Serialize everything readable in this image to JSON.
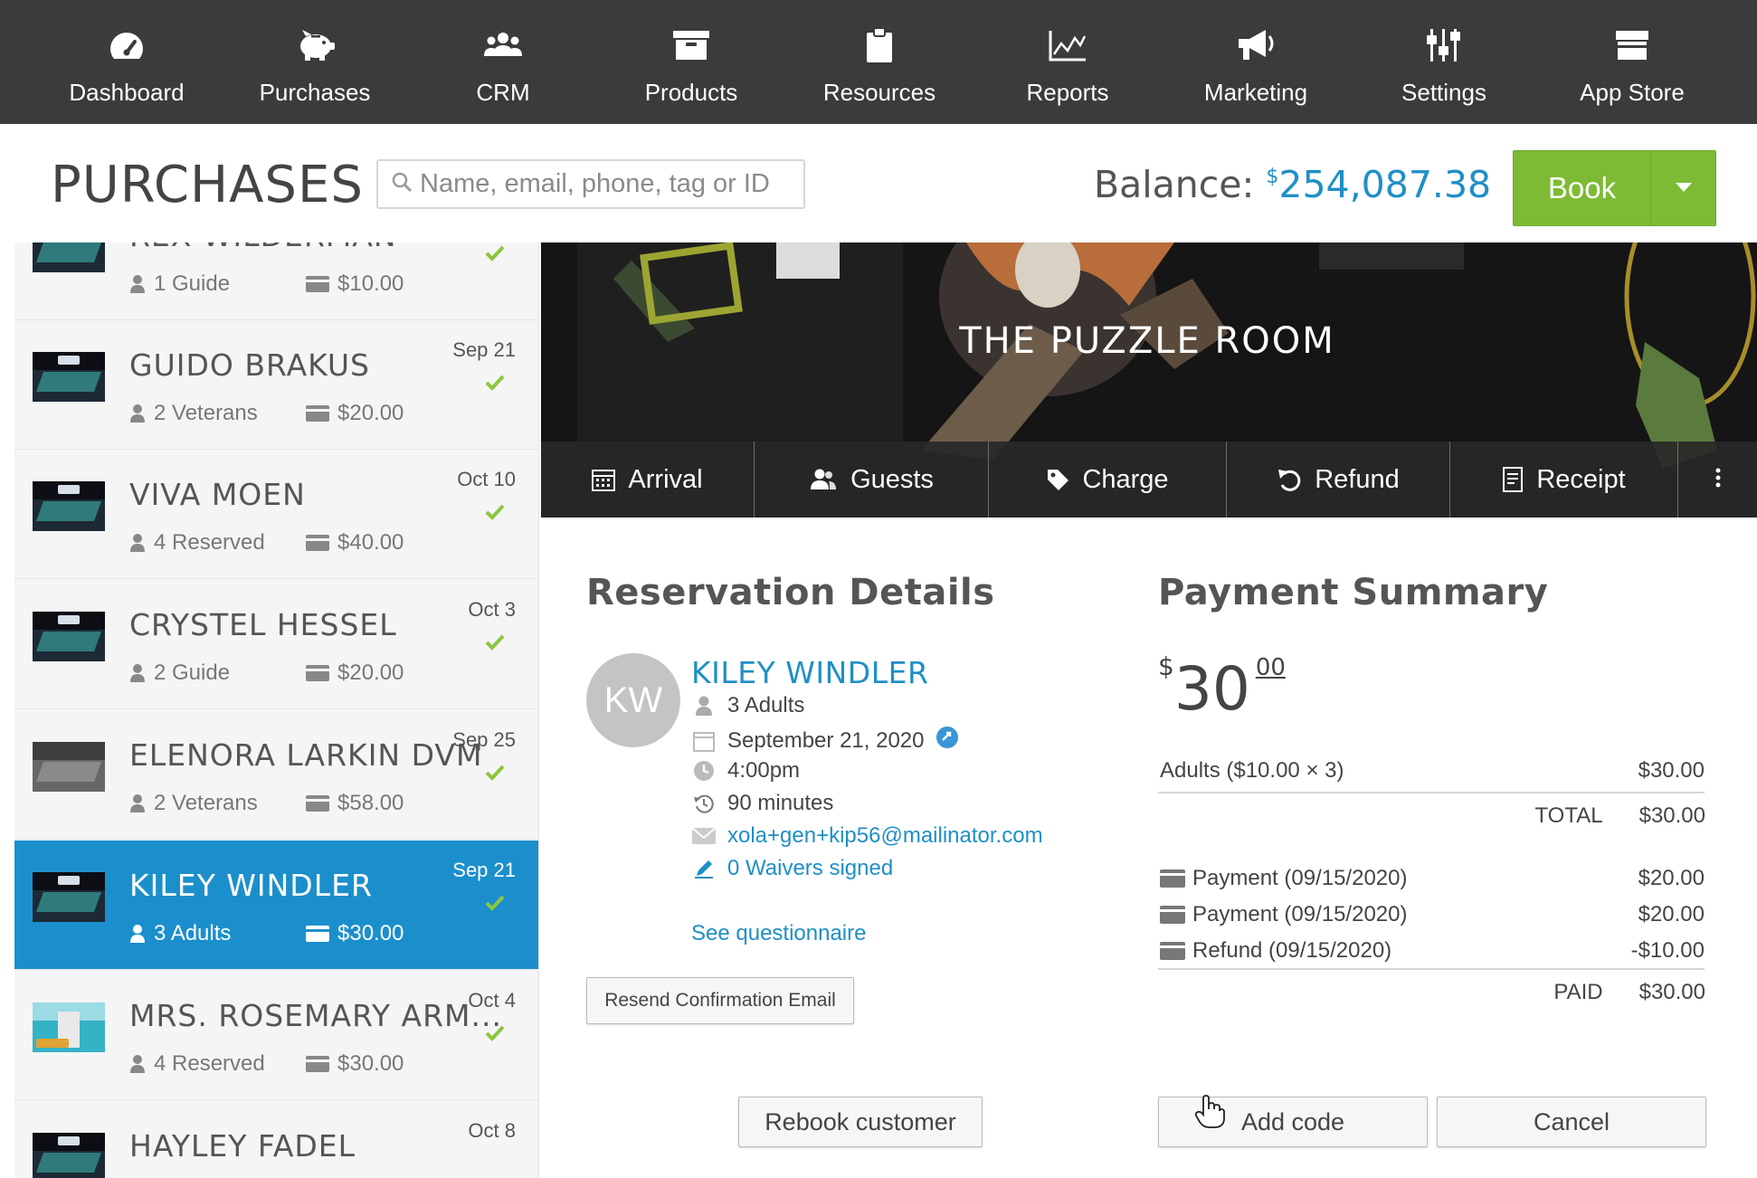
{
  "nav": {
    "items": [
      {
        "label": "Dashboard",
        "icon": "dashboard-gauge-icon"
      },
      {
        "label": "Purchases",
        "icon": "piggy-bank-icon"
      },
      {
        "label": "CRM",
        "icon": "users-group-icon"
      },
      {
        "label": "Products",
        "icon": "archive-box-icon"
      },
      {
        "label": "Resources",
        "icon": "clipboard-icon"
      },
      {
        "label": "Reports",
        "icon": "line-chart-icon"
      },
      {
        "label": "Marketing",
        "icon": "megaphone-icon"
      },
      {
        "label": "Settings",
        "icon": "sliders-icon"
      },
      {
        "label": "App Store",
        "icon": "store-icon"
      }
    ]
  },
  "header": {
    "title": "PURCHASES",
    "search_placeholder": "Name, email, phone, tag or ID",
    "balance_label": "Balance:",
    "balance_currency": "$",
    "balance_amount": "254,087.38",
    "book_label": "Book"
  },
  "purchases": [
    {
      "name": "REX WILDERMAN",
      "date": "",
      "guests": "1 Guide",
      "price": "$10.00",
      "active": false
    },
    {
      "name": "GUIDO BRAKUS",
      "date": "Sep 21",
      "guests": "2 Veterans",
      "price": "$20.00",
      "active": false
    },
    {
      "name": "VIVA MOEN",
      "date": "Oct 10",
      "guests": "4 Reserved",
      "price": "$40.00",
      "active": false
    },
    {
      "name": "CRYSTEL HESSEL",
      "date": "Oct 3",
      "guests": "2 Guide",
      "price": "$20.00",
      "active": false
    },
    {
      "name": "ELENORA LARKIN DVM",
      "date": "Sep 25",
      "guests": "2 Veterans",
      "price": "$58.00",
      "active": false
    },
    {
      "name": "KILEY WINDLER",
      "date": "Sep 21",
      "guests": "3 Adults",
      "price": "$30.00",
      "active": true
    },
    {
      "name": "MRS. ROSEMARY ARM...",
      "date": "Oct 4",
      "guests": "4 Reserved",
      "price": "$30.00",
      "active": false
    },
    {
      "name": "HAYLEY FADEL",
      "date": "Oct 8",
      "guests": "",
      "price": "",
      "active": false
    }
  ],
  "hero": {
    "title": "THE PUZZLE ROOM",
    "actions": [
      {
        "label": "Arrival",
        "icon": "calendar-grid-icon"
      },
      {
        "label": "Guests",
        "icon": "guests-icon"
      },
      {
        "label": "Charge",
        "icon": "tag-icon"
      },
      {
        "label": "Refund",
        "icon": "undo-arrow-icon"
      },
      {
        "label": "Receipt",
        "icon": "receipt-icon"
      }
    ],
    "more_icon": "vertical-ellipsis-icon"
  },
  "reservation": {
    "section_title": "Reservation Details",
    "avatar_initials": "KW",
    "customer_name": "KILEY WINDLER",
    "guests": "3 Adults",
    "date": "September 21, 2020",
    "time": "4:00pm",
    "duration": "90 minutes",
    "email": "xola+gen+kip56@mailinator.com",
    "waivers": "0 Waivers signed",
    "questionnaire": "See questionnaire",
    "resend_label": "Resend Confirmation Email",
    "rebook_label": "Rebook customer"
  },
  "payment": {
    "section_title": "Payment Summary",
    "amount_currency": "$",
    "amount_dollars": "30",
    "amount_cents": "00",
    "line_item_label": "Adults ($10.00 × 3)",
    "line_item_value": "$30.00",
    "total_label": "TOTAL",
    "total_value": "$30.00",
    "transactions": [
      {
        "label": "Payment (09/15/2020)",
        "value": "$20.00"
      },
      {
        "label": "Payment (09/15/2020)",
        "value": "$20.00"
      },
      {
        "label": "Refund (09/15/2020)",
        "value": "-$10.00"
      }
    ],
    "paid_label": "PAID",
    "paid_value": "$30.00",
    "add_code_label": "Add code",
    "cancel_label": "Cancel"
  },
  "colors": {
    "nav_bg": "#3b3b3b",
    "accent_blue": "#1f8fc6",
    "active_row": "#1b8fcc",
    "book_green": "#7dbb34",
    "check_green": "#8cc63f"
  }
}
